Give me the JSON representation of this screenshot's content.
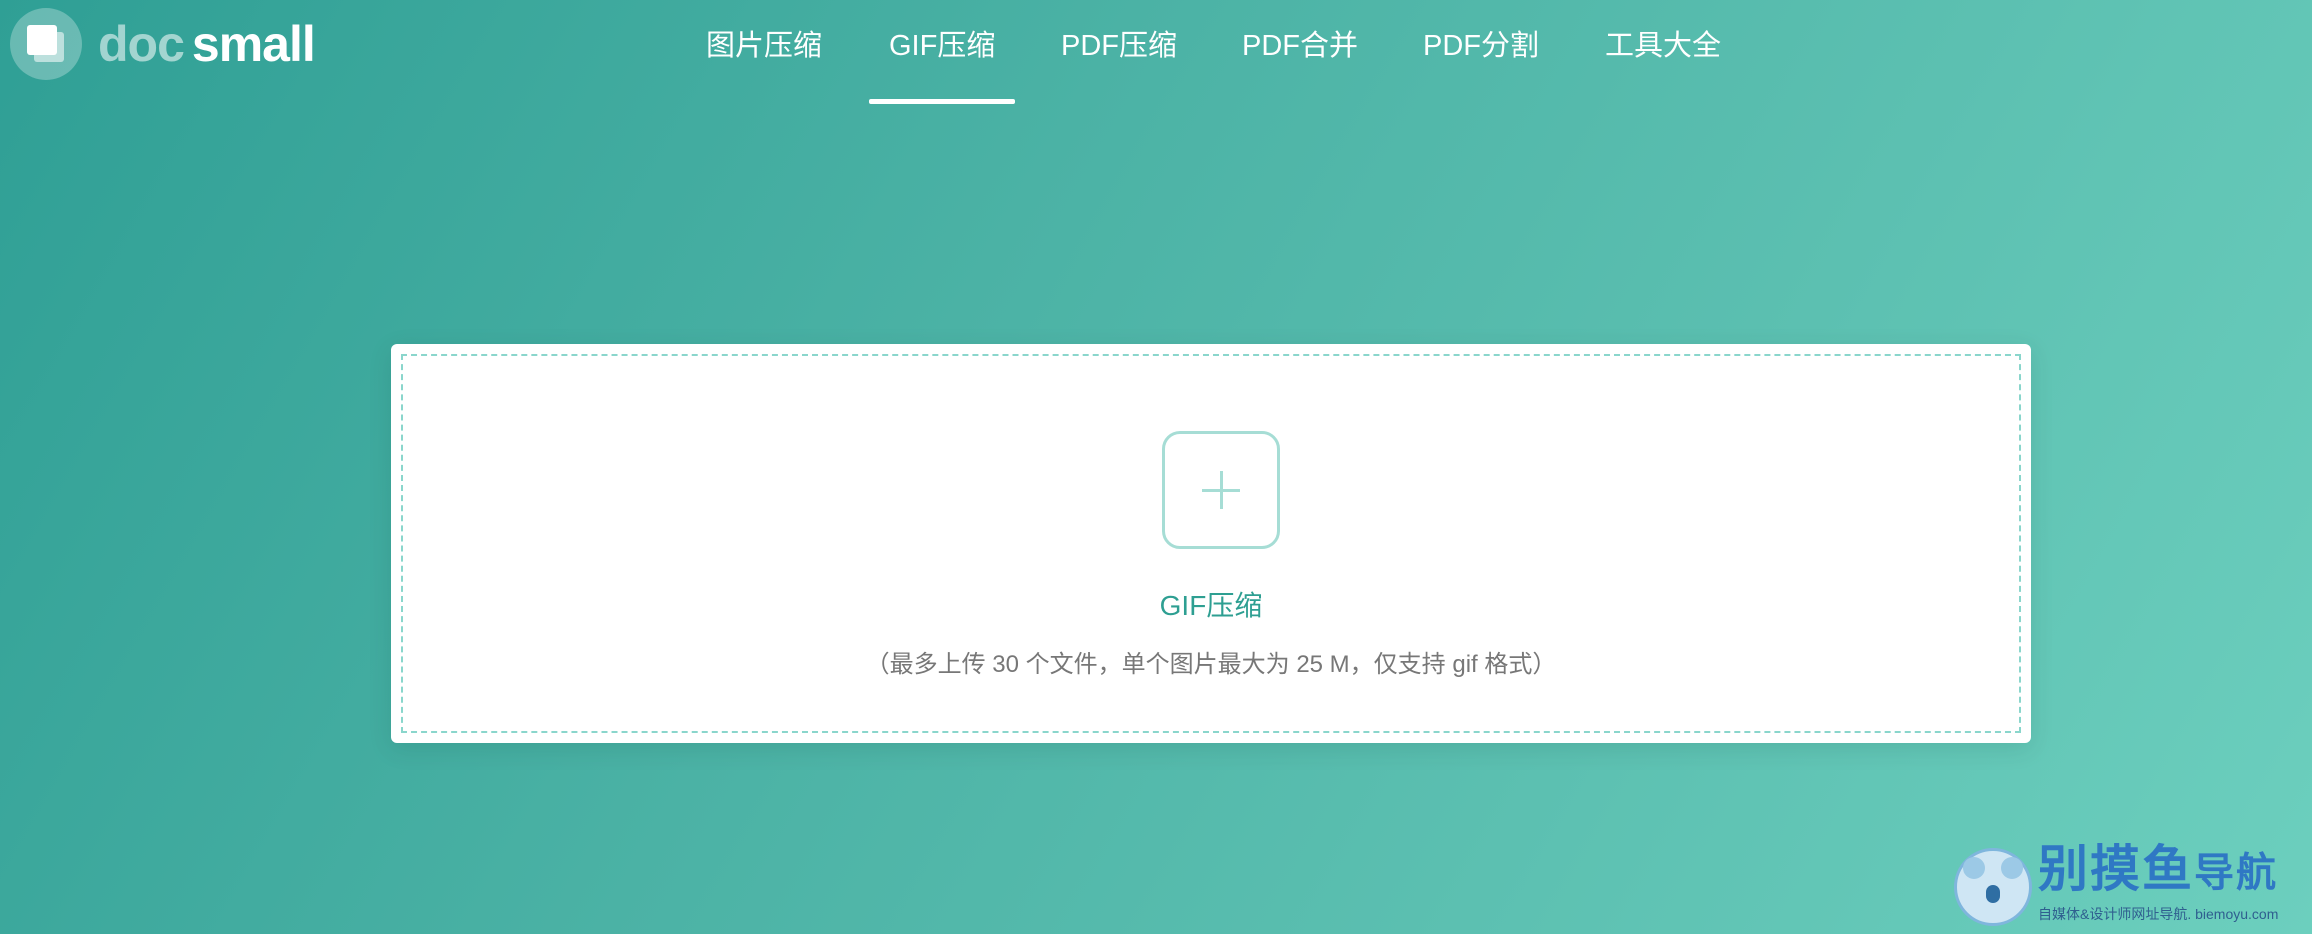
{
  "header": {
    "logo": {
      "part1": "doc",
      "part2": "small"
    },
    "nav": [
      {
        "label": "图片压缩",
        "active": false
      },
      {
        "label": "GIF压缩",
        "active": true
      },
      {
        "label": "PDF压缩",
        "active": false
      },
      {
        "label": "PDF合并",
        "active": false
      },
      {
        "label": "PDF分割",
        "active": false
      },
      {
        "label": "工具大全",
        "active": false
      }
    ]
  },
  "upload": {
    "title": "GIF压缩",
    "subtitle": "（最多上传 30 个文件，单个图片最大为 25 M，仅支持 gif 格式）",
    "icon": "plus-icon"
  },
  "watermark": {
    "title_main": "别摸鱼",
    "title_suffix": "导航",
    "subtitle": "自媒体&设计师网址导航. biemoyu.com"
  },
  "colors": {
    "background_start": "#2f9f95",
    "background_end": "#6ccfbe",
    "accent": "#2e9f92",
    "dashed_border": "#8ad6cc",
    "plus_icon": "#a6ddd5",
    "subtitle_text": "#777777"
  }
}
